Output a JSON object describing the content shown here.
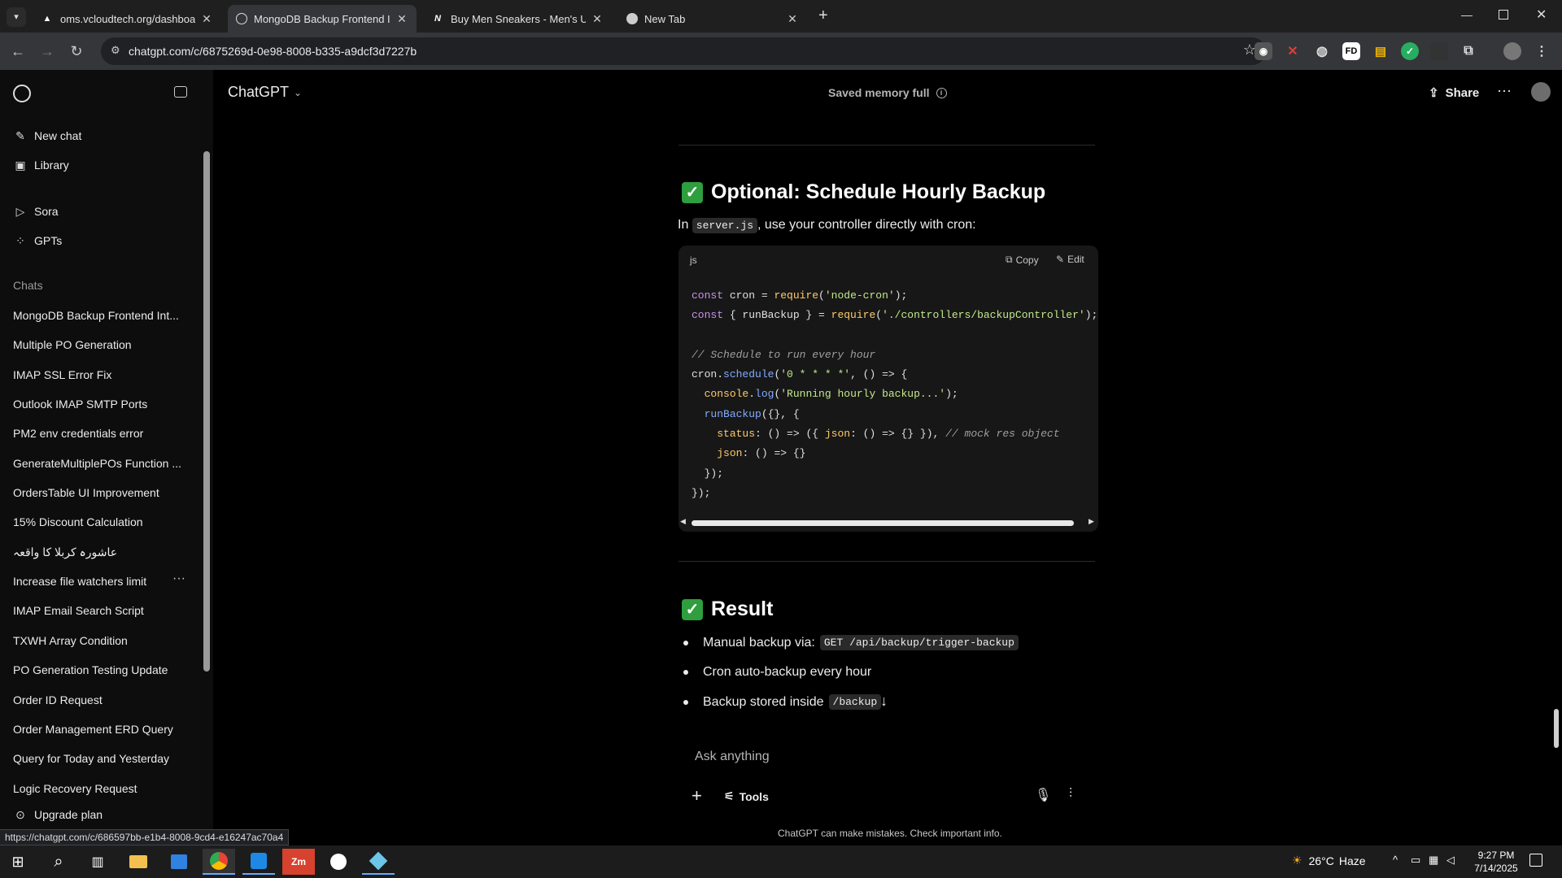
{
  "browser": {
    "tabs": [
      {
        "title": "oms.vcloudtech.org/dashboard",
        "active": false
      },
      {
        "title": "MongoDB Backup Frontend Int",
        "active": true
      },
      {
        "title": "Buy Men Sneakers - Men's Urba",
        "active": false
      },
      {
        "title": "New Tab",
        "active": false
      }
    ],
    "url": "chatgpt.com/c/6875269d-0e98-8008-b335-a9dcf3d7227b",
    "status_url": "https://chatgpt.com/c/686597bb-e1b4-8008-9cd4-e16247ac70a4",
    "extensions": [
      "FD"
    ]
  },
  "sidebar": {
    "top": [
      {
        "label": "New chat",
        "icon": "edit-icon"
      },
      {
        "label": "Library",
        "icon": "library-icon"
      }
    ],
    "apps": [
      {
        "label": "Sora",
        "icon": "play-icon"
      },
      {
        "label": "GPTs",
        "icon": "grid-icon"
      }
    ],
    "chats_heading": "Chats",
    "chats": [
      "MongoDB Backup Frontend Int...",
      "Multiple PO Generation",
      "IMAP SSL Error Fix",
      "Outlook IMAP SMTP Ports",
      "PM2 env credentials error",
      "GenerateMultiplePOs Function ...",
      "OrdersTable UI Improvement",
      "15% Discount Calculation",
      "عاشورہ کربلا کا واقعہ",
      "Increase file watchers limit",
      "IMAP Email Search Script",
      "TXWH Array Condition",
      "PO Generation Testing Update",
      "Order ID Request",
      "Order Management ERD Query",
      "Query for Today and Yesterday",
      "Logic Recovery Request"
    ],
    "upgrade_label": "Upgrade plan"
  },
  "header": {
    "model": "ChatGPT",
    "memory_status": "Saved memory full",
    "share_label": "Share"
  },
  "content": {
    "section1_title": "Optional: Schedule Hourly Backup",
    "section1_text_pre": "In",
    "section1_code": "server.js",
    "section1_text_post": ", use your controller directly with cron:",
    "codeblock": {
      "lang": "js",
      "copy_label": "Copy",
      "edit_label": "Edit"
    },
    "section2_title": "Result",
    "bullets": [
      {
        "text": "Manual backup via:",
        "code": "GET /api/backup/trigger-backup"
      },
      {
        "text": "Cron auto-backup every hour",
        "code": ""
      },
      {
        "text": "Backup stored inside",
        "code": "/backup"
      }
    ]
  },
  "composer": {
    "placeholder": "Ask anything",
    "tools_label": "Tools",
    "disclaimer": "ChatGPT can make mistakes. Check important info."
  },
  "taskbar": {
    "weather_temp": "26°C",
    "weather_text": "Haze",
    "time": "9:27 PM",
    "date": "7/14/2025"
  }
}
